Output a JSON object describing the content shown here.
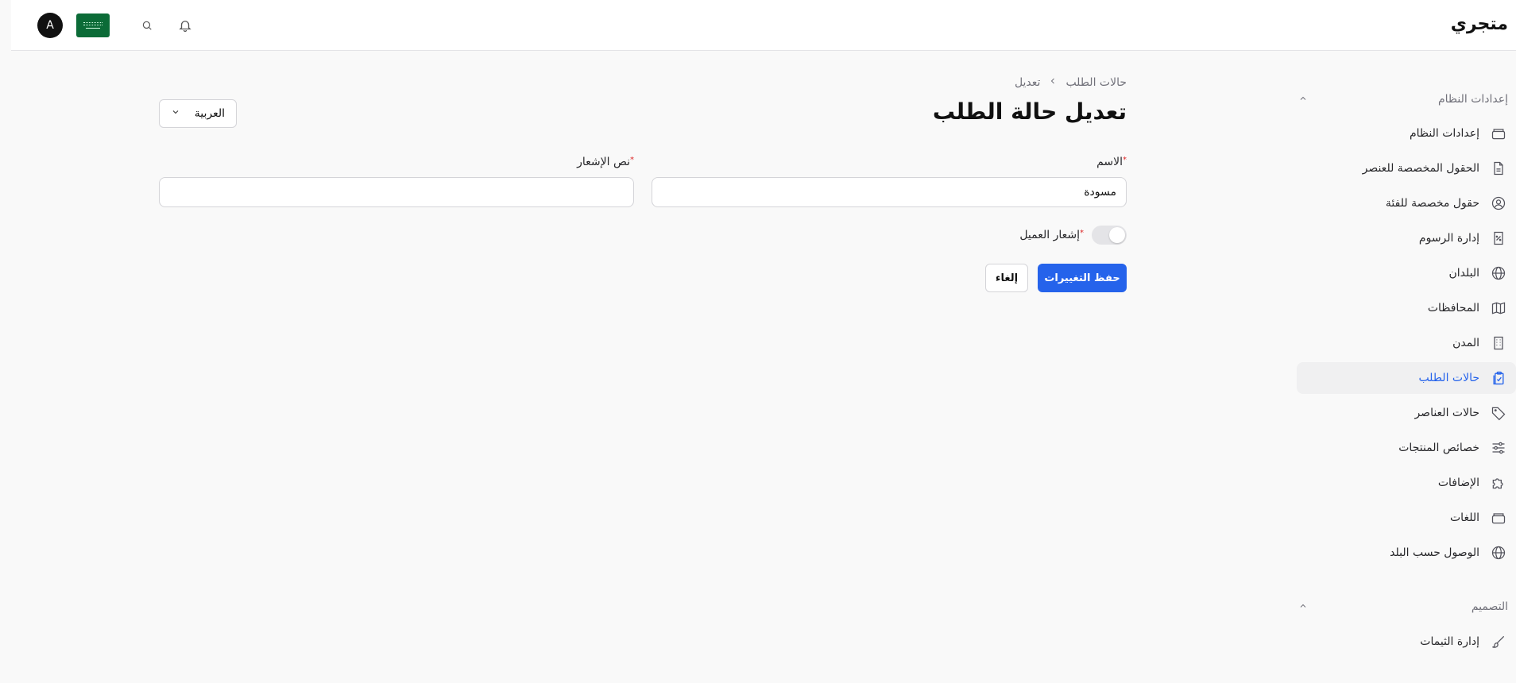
{
  "header": {
    "brand": "متجري",
    "avatar_letter": "A"
  },
  "sidebar": {
    "section_system": "إعدادات النظام",
    "items": [
      {
        "label": "إعدادات النظام",
        "icon": "archive-icon"
      },
      {
        "label": "الحقول المخصصة للعنصر",
        "icon": "file-icon"
      },
      {
        "label": "حقول مخصصة للفئة",
        "icon": "user-circle-icon"
      },
      {
        "label": "إدارة الرسوم",
        "icon": "percent-receipt-icon"
      },
      {
        "label": "البلدان",
        "icon": "globe-icon"
      },
      {
        "label": "المحافظات",
        "icon": "map-icon"
      },
      {
        "label": "المدن",
        "icon": "building-icon"
      },
      {
        "label": "حالات الطلب",
        "icon": "clipboard-check-icon"
      },
      {
        "label": "حالات العناصر",
        "icon": "tag-icon"
      },
      {
        "label": "خصائص المنتجات",
        "icon": "sliders-icon"
      },
      {
        "label": "الإضافات",
        "icon": "puzzle-icon"
      },
      {
        "label": "اللغات",
        "icon": "archive-icon"
      },
      {
        "label": "الوصول حسب البلد",
        "icon": "globe-icon"
      }
    ],
    "section_design": "التصميم",
    "design_items": [
      {
        "label": "إدارة الثيمات",
        "icon": "brush-icon"
      }
    ]
  },
  "main": {
    "breadcrumb": {
      "parent": "حالات الطلب",
      "current": "تعديل"
    },
    "title": "تعديل حالة الطلب",
    "language_select": "العربية",
    "form": {
      "name_label": "الاسم",
      "name_value": "مسودة",
      "notification_label": "نص الإشعار",
      "notification_value": "",
      "notify_customer_label": "إشعار العميل",
      "notify_customer_on": false
    },
    "buttons": {
      "save": "حفظ التغييرات",
      "cancel": "إلغاء"
    }
  },
  "colors": {
    "accent": "#2563eb",
    "required": "#dc2626",
    "flag": "#0b6b37"
  }
}
